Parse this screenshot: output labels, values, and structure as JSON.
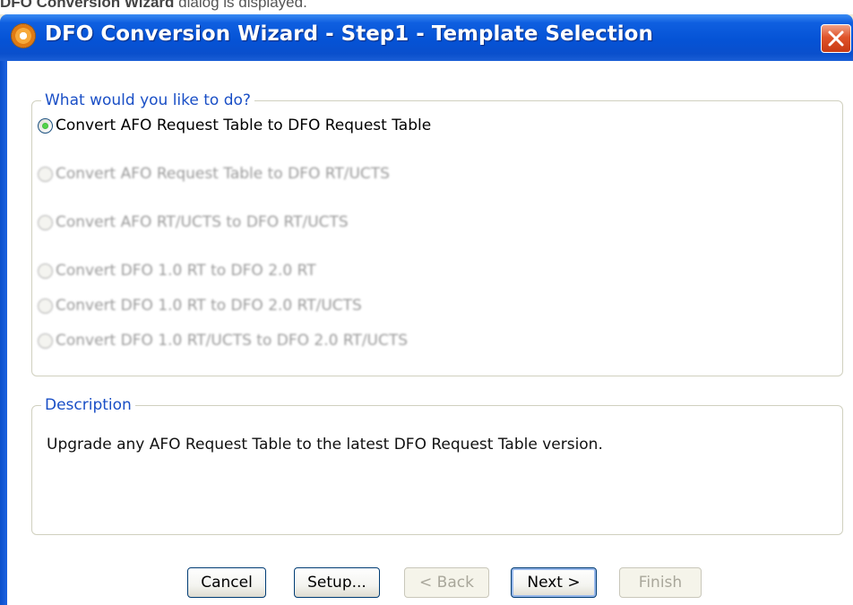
{
  "document": {
    "caption_bold": "DFO Conversion Wizard",
    "caption_rest": " dialog is displayed."
  },
  "window": {
    "title": "DFO Conversion Wizard - Step1 - Template Selection"
  },
  "options": {
    "legend": "What would you like to do?",
    "items": [
      {
        "label": "Convert AFO Request Table to DFO Request Table",
        "selected": true,
        "enabled": true
      },
      {
        "label": "Convert AFO Request Table to DFO RT/UCTS",
        "selected": false,
        "enabled": false
      },
      {
        "label": "Convert AFO RT/UCTS to DFO RT/UCTS",
        "selected": false,
        "enabled": false
      },
      {
        "label": "Convert DFO 1.0 RT to DFO 2.0 RT",
        "selected": false,
        "enabled": false
      },
      {
        "label": "Convert DFO 1.0 RT to DFO 2.0 RT/UCTS",
        "selected": false,
        "enabled": false
      },
      {
        "label": "Convert DFO 1.0 RT/UCTS to DFO 2.0 RT/UCTS",
        "selected": false,
        "enabled": false
      }
    ]
  },
  "description": {
    "legend": "Description",
    "text": "Upgrade any AFO Request Table to the latest DFO Request Table version."
  },
  "buttons": {
    "cancel": "Cancel",
    "setup": "Setup...",
    "back": "< Back",
    "next": "Next >",
    "finish": "Finish"
  },
  "colors": {
    "titlebar": "#0553d6",
    "legend_text": "#1a4fc6",
    "close_button": "#e0542a"
  }
}
